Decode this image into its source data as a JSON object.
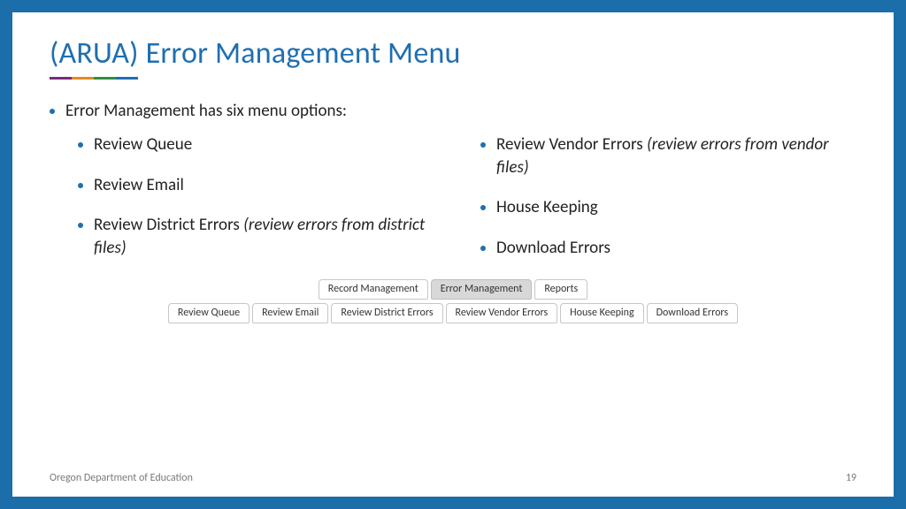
{
  "title": "(ARUA) Error Management Menu",
  "intro": "Error Management has six menu options:",
  "left_items": [
    {
      "text": "Review Queue",
      "note": ""
    },
    {
      "text": "Review Email",
      "note": ""
    },
    {
      "text": "Review District Errors ",
      "note": "(review errors from district files)"
    }
  ],
  "right_items": [
    {
      "text": "Review Vendor Errors ",
      "note": "(review errors from vendor files)"
    },
    {
      "text": "House Keeping",
      "note": ""
    },
    {
      "text": "Download Errors",
      "note": ""
    }
  ],
  "tabs_top": [
    {
      "label": "Record Management",
      "active": false
    },
    {
      "label": "Error Management",
      "active": true
    },
    {
      "label": "Reports",
      "active": false
    }
  ],
  "tabs_bottom": [
    "Review Queue",
    "Review Email",
    "Review District Errors",
    "Review Vendor Errors",
    "House Keeping",
    "Download Errors"
  ],
  "footer_left": "Oregon Department of Education",
  "footer_right": "19"
}
